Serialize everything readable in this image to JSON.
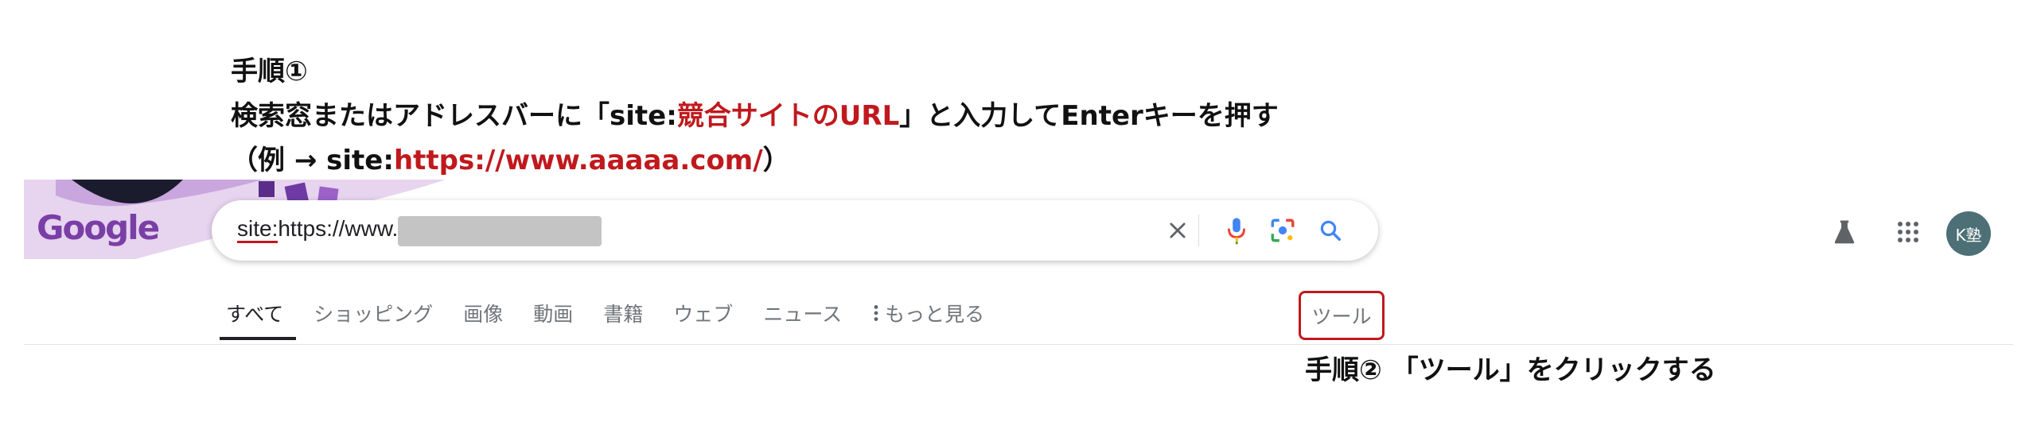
{
  "instructions": {
    "step1_title": "手順①",
    "line1_a": "検索窓またはアドレスバーに「site:",
    "line1_red": "競合サイトのURL",
    "line1_b": "」と入力してEnterキーを押す",
    "line2_a": "（例 → site:",
    "line2_red": "https://www.aaaaa.com/",
    "line2_b": "）",
    "step2": "手順② 「ツール」をクリックする"
  },
  "logo": {
    "text": "Google",
    "icon": "google-doodle-logo"
  },
  "search": {
    "query_site": "site:",
    "query_rest": "https://www.",
    "clear_icon": "close-icon",
    "voice_icon": "microphone-icon",
    "lens_icon": "camera-lens-icon",
    "search_icon": "search-icon"
  },
  "header_icons": {
    "labs": "flask-icon",
    "apps": "apps-grid-icon"
  },
  "avatar": {
    "text": "K塾"
  },
  "tabs": [
    "すべて",
    "ショッピング",
    "画像",
    "動画",
    "書籍",
    "ウェブ",
    "ニュース"
  ],
  "more_label": "もっと見る",
  "tools_label": "ツール",
  "colors": {
    "accent_red": "#c0191d",
    "doodle_purple": "#7a3fa6"
  }
}
